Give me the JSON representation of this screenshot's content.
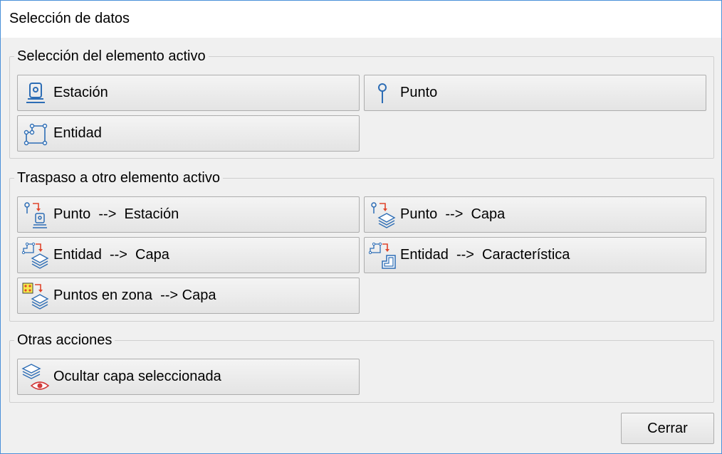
{
  "window": {
    "title": "Selección de datos"
  },
  "groups": {
    "active": {
      "legend": "Selección del elemento activo",
      "buttons": {
        "estacion": {
          "label": "Estación",
          "icon": "station-icon"
        },
        "punto": {
          "label": "Punto",
          "icon": "point-pin-icon"
        },
        "entidad": {
          "label": "Entidad",
          "icon": "entity-polyline-icon"
        }
      }
    },
    "transfer": {
      "legend": "Traspaso a otro elemento activo",
      "buttons": {
        "punto_estacion": {
          "label": "Punto  -->  Estación",
          "icon": "point-to-station-icon"
        },
        "punto_capa": {
          "label": "Punto  -->  Capa",
          "icon": "point-to-layer-icon"
        },
        "entidad_capa": {
          "label": "Entidad  -->  Capa",
          "icon": "entity-to-layer-icon"
        },
        "entidad_caracteristica": {
          "label": "Entidad  -->  Característica",
          "icon": "entity-to-feature-icon"
        },
        "puntos_zona_capa": {
          "label": "Puntos en zona  --> Capa",
          "icon": "zone-points-to-layer-icon"
        }
      }
    },
    "other": {
      "legend": "Otras acciones",
      "buttons": {
        "ocultar_capa": {
          "label": "Ocultar capa seleccionada",
          "icon": "hide-layer-icon"
        }
      }
    }
  },
  "footer": {
    "close_label": "Cerrar"
  },
  "colors": {
    "icon_blue": "#2d6db5",
    "arrow_red": "#e0452c",
    "border": "#4a90d9"
  }
}
